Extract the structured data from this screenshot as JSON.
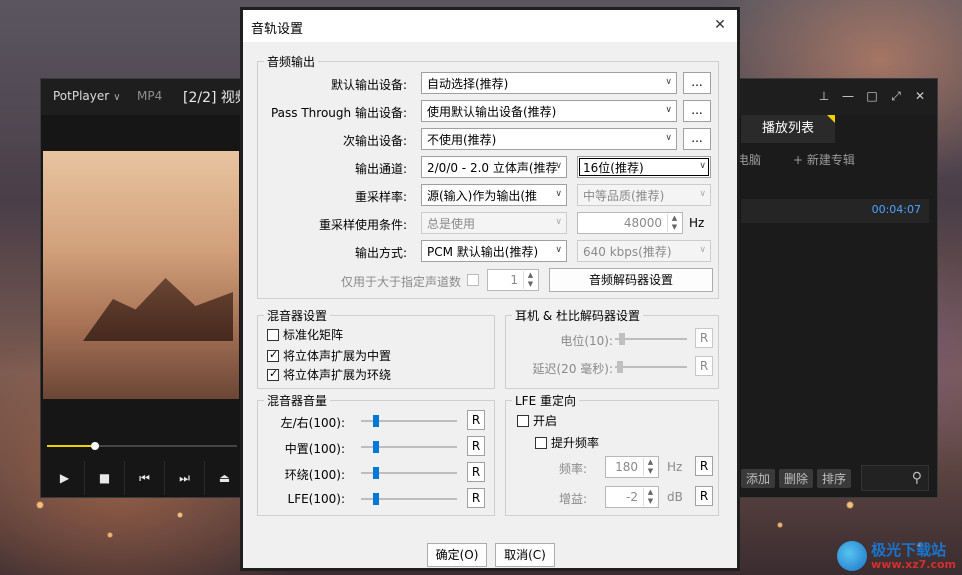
{
  "player": {
    "brand": "PotPlayer",
    "format": "MP4",
    "title": "[2/2] 视频",
    "playlist_tab": "播放列表",
    "playlist_sub_left": "电脑",
    "playlist_sub_right": "+ 新建专辑",
    "track_duration": "00:04:07",
    "actions": [
      "添加",
      "删除",
      "排序"
    ],
    "seek_progress": 0.25
  },
  "dialog": {
    "title": "音轨设置",
    "audio_output": {
      "legend": "音频输出",
      "default_device_label": "默认输出设备:",
      "default_device_value": "自动选择(推荐)",
      "passthrough_label": "Pass Through 输出设备:",
      "passthrough_value": "使用默认输出设备(推荐)",
      "secondary_label": "次输出设备:",
      "secondary_value": "不使用(推荐)",
      "ellipsis": "...",
      "channel_label": "输出通道:",
      "channel_value": "2/0/0 - 2.0 立体声(推荐",
      "bitdepth_value": "16位(推荐)",
      "resample_label": "重采样率:",
      "resample_value": "源(输入)作为输出(推",
      "quality_value": "中等品质(推荐)",
      "resample_cond_label": "重采样使用条件:",
      "resample_cond_value": "总是使用",
      "hz_value": "48000",
      "hz_unit": "Hz",
      "output_mode_label": "输出方式:",
      "output_mode_value": "PCM 默认输出(推荐)",
      "bitrate_value": "640 kbps(推荐)",
      "only_above_label": "仅用于大于指定声道数",
      "only_above_value": "1",
      "decoder_button": "音频解码器设置"
    },
    "mixer": {
      "legend": "混音器设置",
      "normalize": "标准化矩阵",
      "normalize_checked": false,
      "stereo_center": "将立体声扩展为中置",
      "stereo_center_checked": true,
      "stereo_surround": "将立体声扩展为环绕",
      "stereo_surround_checked": true
    },
    "headphone": {
      "legend": "耳机 & 杜比解码器设置",
      "level_label": "电位(10):",
      "delay_label": "延迟(20 毫秒):",
      "reset": "R"
    },
    "volume": {
      "legend": "混音器音量",
      "rows": [
        {
          "label": "左/右(100):",
          "level": 0.13
        },
        {
          "label": "中置(100):",
          "level": 0.13
        },
        {
          "label": "环绕(100):",
          "level": 0.13
        },
        {
          "label": "LFE(100):",
          "level": 0.13
        }
      ],
      "reset": "R"
    },
    "lfe": {
      "legend": "LFE 重定向",
      "enable": "开启",
      "boost": "提升频率",
      "freq_label": "频率:",
      "freq_value": "180",
      "freq_unit": "Hz",
      "gain_label": "增益:",
      "gain_value": "-2",
      "gain_unit": "dB",
      "reset": "R"
    },
    "ok": "确定(O)",
    "cancel": "取消(C)"
  },
  "watermark": {
    "text": "极光下载站",
    "url": "www.xz7.com"
  }
}
